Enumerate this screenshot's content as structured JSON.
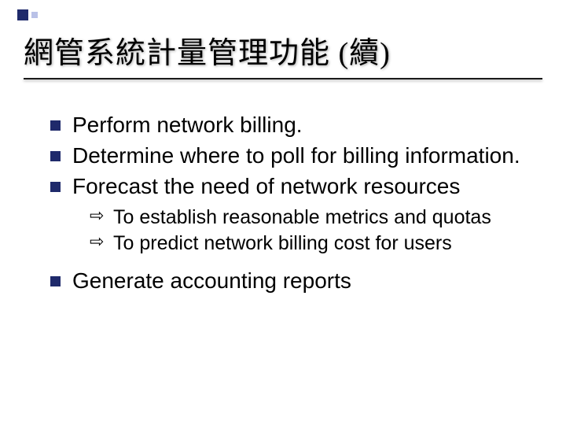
{
  "title": "網管系統計量管理功能 (續)",
  "bullets": [
    {
      "text": "Perform network billing."
    },
    {
      "text": "Determine where to poll for billing information."
    },
    {
      "text": "Forecast the need of network resources",
      "sub": [
        "To establish reasonable metrics and quotas",
        "To predict network billing cost for users"
      ]
    },
    {
      "text": "Generate accounting reports"
    }
  ]
}
